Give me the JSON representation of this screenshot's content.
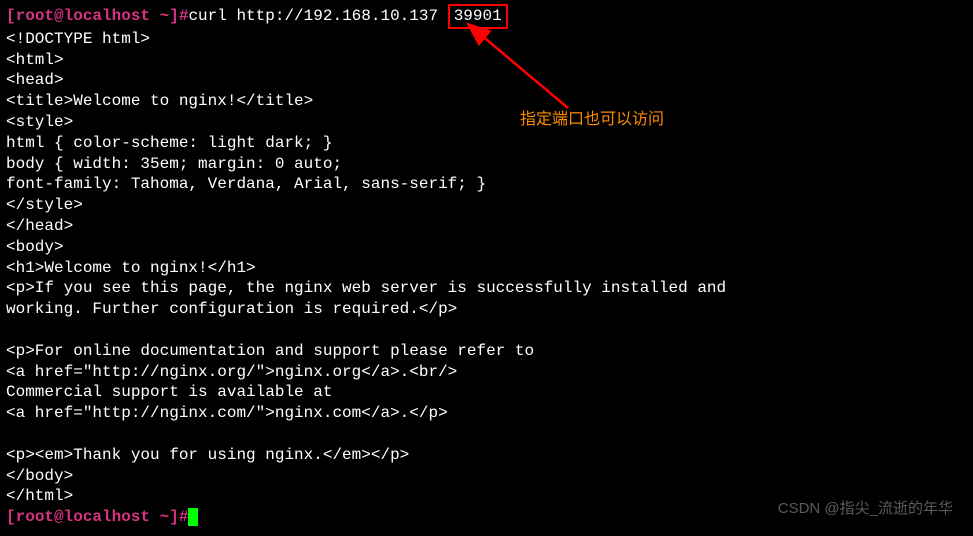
{
  "prompt1": {
    "open": "[",
    "user_host": "root@localhost",
    "path": " ~",
    "close": "]#",
    "command_before_port": "curl http://192.168.10.137",
    "port": "39901"
  },
  "output_lines": [
    "<!DOCTYPE html>",
    "<html>",
    "<head>",
    "<title>Welcome to nginx!</title>",
    "<style>",
    "html { color-scheme: light dark; }",
    "body { width: 35em; margin: 0 auto;",
    "font-family: Tahoma, Verdana, Arial, sans-serif; }",
    "</style>",
    "</head>",
    "<body>",
    "<h1>Welcome to nginx!</h1>",
    "<p>If you see this page, the nginx web server is successfully installed and",
    "working. Further configuration is required.</p>",
    "",
    "<p>For online documentation and support please refer to",
    "<a href=\"http://nginx.org/\">nginx.org</a>.<br/>",
    "Commercial support is available at",
    "<a href=\"http://nginx.com/\">nginx.com</a>.</p>",
    "",
    "<p><em>Thank you for using nginx.</em></p>",
    "</body>",
    "</html>"
  ],
  "prompt2": {
    "open": "[",
    "user_host": "root@localhost",
    "path": " ~",
    "close": "]#"
  },
  "annotation": "指定端口也可以访问",
  "watermark": "CSDN @指尖_流逝的年华"
}
